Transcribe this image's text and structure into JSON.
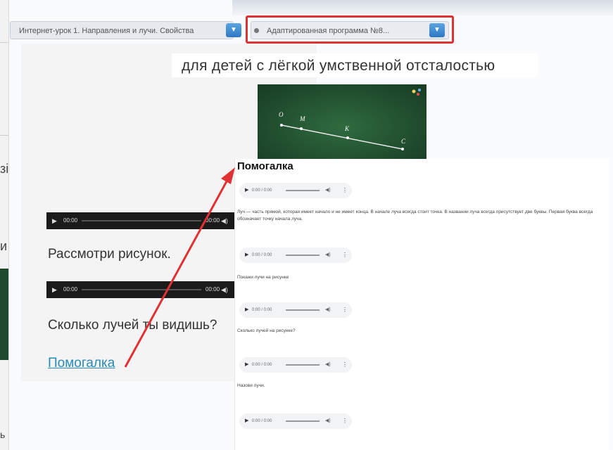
{
  "header": {
    "lesson_select_value": "Интернет-урок 1. Направления и лучи. Свойства",
    "program_select_value": "Адаптированная программа №8...",
    "dropdown_glyph": "▼"
  },
  "main": {
    "subtitle": "для детей с лёгкой умственной отсталостью",
    "instruction_1": "Рассмотри рисунок.",
    "question": "Сколько лучей ты видишь?",
    "help_link": "Помогалка",
    "board_letters": [
      "O",
      "M",
      "K",
      "C"
    ],
    "audio_time_start": "00:00",
    "audio_time_end": "00:00",
    "play_glyph": "▶",
    "volume_glyph": "◀)"
  },
  "left_strip": {
    "chars": [
      "зі",
      "и",
      "ь"
    ]
  },
  "popup": {
    "title": "Помогалка",
    "player_time": "0:00 / 0:00",
    "paragraphs": [
      "Луч — часть прямой, которая имеет начало и не имеет конца. В начале луча всегда стоит точка. В названии луча всегда присутствует две буквы. Первая буква всегда обозначает точку начала луча.",
      "Покажи лучи на рисунке",
      "Сколько лучей на рисунке?",
      "Назови лучи."
    ]
  },
  "colors": {
    "annotation": "#e03232",
    "link": "#2a8ab8",
    "board": "#1f4a2c",
    "dropdown_button": "#2f78c4"
  },
  "icons": [
    "chevron-down-icon",
    "play-icon",
    "volume-icon",
    "more-options-icon"
  ]
}
